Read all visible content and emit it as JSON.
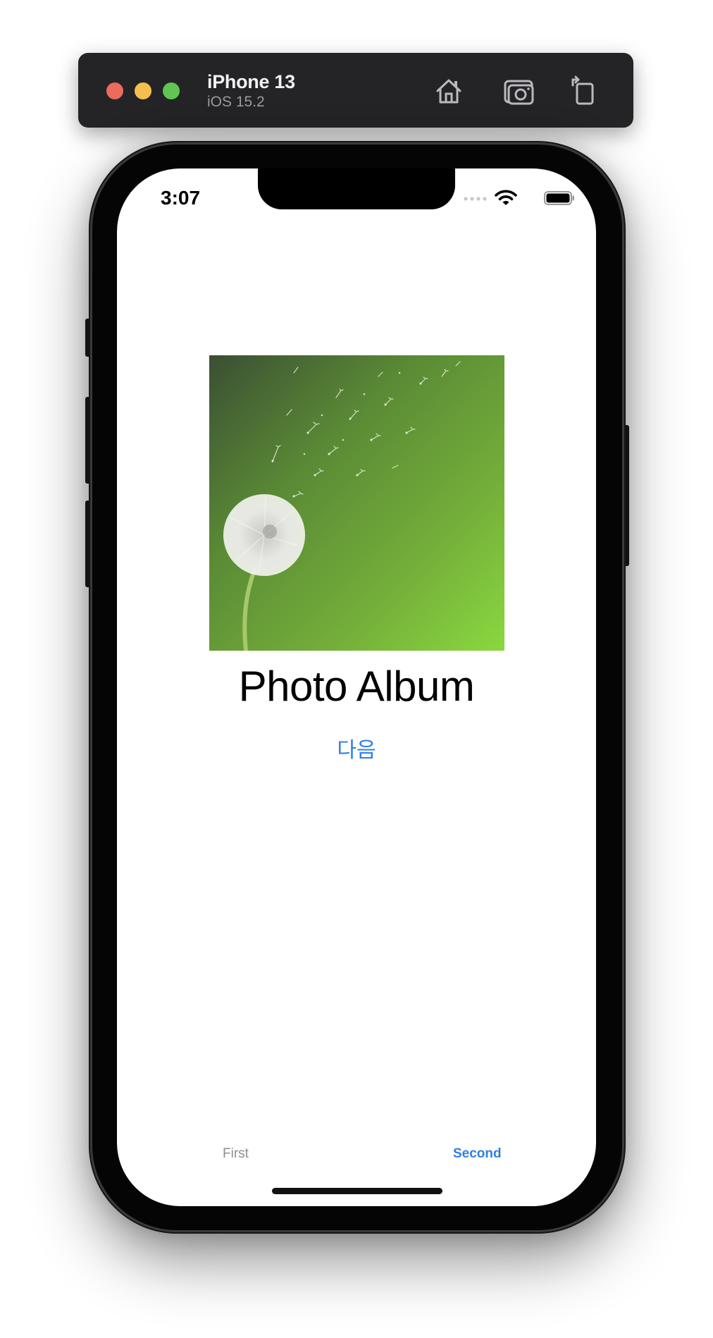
{
  "simulator": {
    "device_name": "iPhone 13",
    "os_version": "iOS 15.2",
    "tools": [
      "home-icon",
      "screenshot-icon",
      "rotate-icon"
    ]
  },
  "status_bar": {
    "time": "3:07"
  },
  "main": {
    "image_subject": "dandelion",
    "title": "Photo Album",
    "next_button": "다음"
  },
  "tab_bar": {
    "tabs": [
      {
        "label": "First",
        "selected": false
      },
      {
        "label": "Second",
        "selected": true
      }
    ]
  },
  "colors": {
    "accent": "#2f7fe6",
    "inactive_tab": "#8e8e93",
    "toolbar_bg": "#242427"
  }
}
